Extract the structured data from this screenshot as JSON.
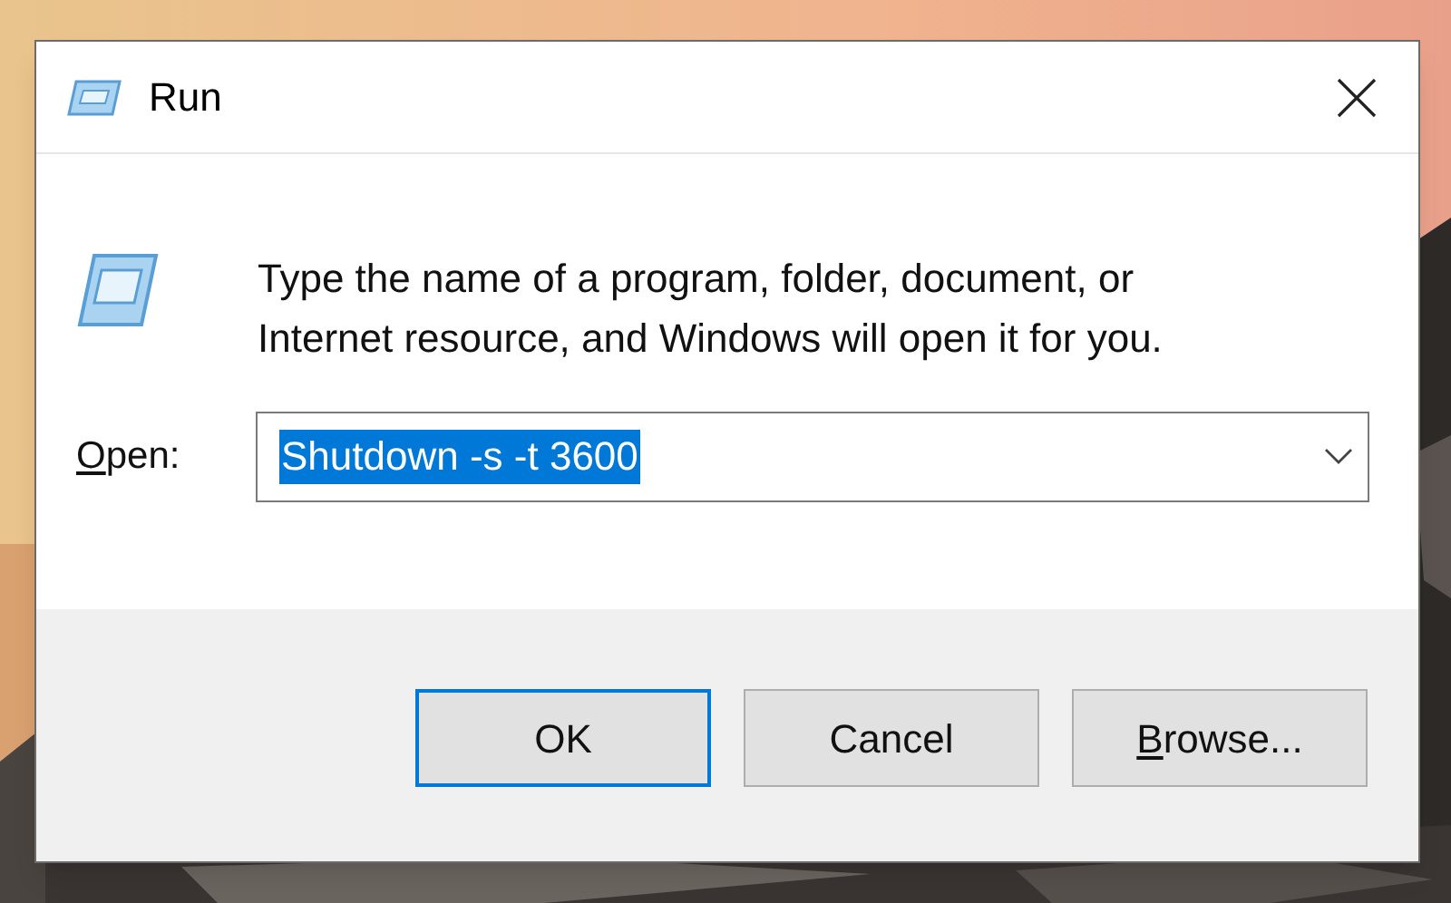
{
  "window": {
    "title": "Run"
  },
  "message": "Type the name of a program, folder, document, or Internet resource, and Windows will open it for you.",
  "open_field": {
    "label": "Open:",
    "label_underline_first": true,
    "value": "Shutdown -s -t 3600",
    "value_selected": true
  },
  "buttons": [
    {
      "label": "OK",
      "default": true,
      "underline_first": false
    },
    {
      "label": "Cancel",
      "default": false,
      "underline_first": false
    },
    {
      "label": "Browse...",
      "default": false,
      "underline_first": true
    }
  ]
}
